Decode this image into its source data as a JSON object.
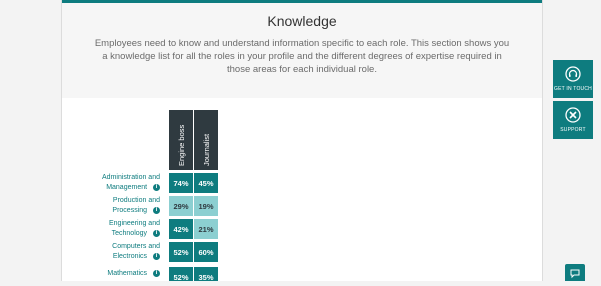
{
  "section": {
    "title": "Knowledge",
    "description": "Employees need to know and understand information specific to each role. This section shows you a knowledge list for all the roles in your profile and the different degrees of expertise required in those areas for each individual role."
  },
  "matrix": {
    "roles": [
      "Engine boss",
      "Journalist"
    ],
    "rows": [
      {
        "label_line1": "Administration and",
        "label_line2": "Management",
        "values": [
          "74%",
          "45%"
        ],
        "levels": [
          "high",
          "high"
        ]
      },
      {
        "label_line1": "Production and",
        "label_line2": "Processing",
        "values": [
          "29%",
          "19%"
        ],
        "levels": [
          "low",
          "low"
        ]
      },
      {
        "label_line1": "Engineering and",
        "label_line2": "Technology",
        "values": [
          "42%",
          "21%"
        ],
        "levels": [
          "high",
          "low"
        ]
      },
      {
        "label_line1": "Computers and",
        "label_line2": "Electronics",
        "values": [
          "52%",
          "60%"
        ],
        "levels": [
          "high",
          "high"
        ]
      },
      {
        "label_line1": "",
        "label_line2": "Mathematics",
        "values": [
          "52%",
          "35%"
        ],
        "levels": [
          "high",
          "high"
        ]
      }
    ],
    "info_glyph": "i"
  },
  "side_buttons": {
    "get_in_touch": "GET IN TOUCH",
    "support": "SUPPORT"
  },
  "colors": {
    "accent": "#0e7c7f",
    "accent_light": "#8ccfd1",
    "header_dark": "#2f3a40"
  },
  "icons": {
    "get_in_touch": "headset-icon",
    "support": "close-circle-icon",
    "info": "info-icon",
    "chat": "chat-icon"
  }
}
